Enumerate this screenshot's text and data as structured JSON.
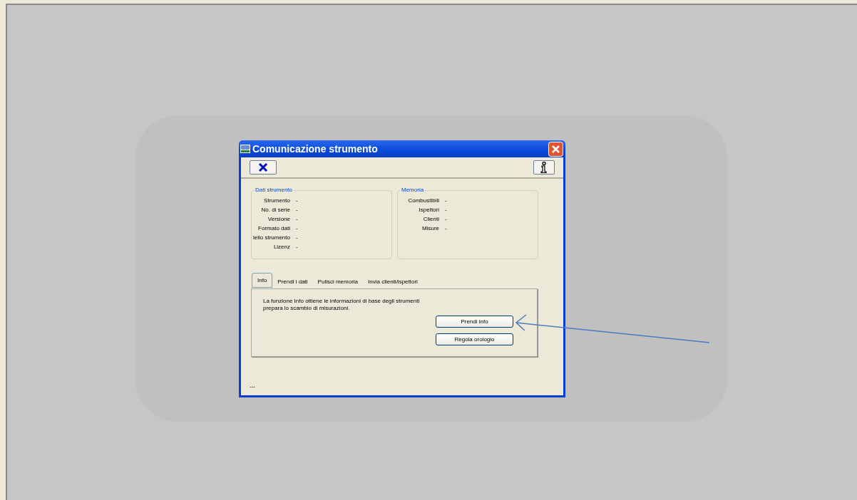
{
  "window": {
    "title": "Comunicazione strumento"
  },
  "groups": [
    {
      "title": "Dati strumento",
      "fields": [
        {
          "label": "Strumento",
          "value": "-"
        },
        {
          "label": "No. di serie",
          "value": "-"
        },
        {
          "label": "Versione",
          "value": "-"
        },
        {
          "label": "Formato dati",
          "value": "-"
        },
        {
          "label": "lello strumento",
          "value": "-"
        },
        {
          "label": "Lizenz",
          "value": "-"
        }
      ]
    },
    {
      "title": "Memoria",
      "fields": [
        {
          "label": "Combustibili",
          "value": "-"
        },
        {
          "label": "Ispettori",
          "value": "-"
        },
        {
          "label": "Clienti",
          "value": "-"
        },
        {
          "label": "Misure",
          "value": "-"
        }
      ]
    }
  ],
  "tabs": [
    {
      "label": "Info",
      "selected": true
    },
    {
      "label": "Prendi i dati",
      "selected": false
    },
    {
      "label": "Pulisci memoria",
      "selected": false
    },
    {
      "label": "Invia clienti/ispettori",
      "selected": false
    }
  ],
  "panel": {
    "description_lines": [
      "La funzione Info ottiene le informazioni di base degli strumenti",
      "prepara lo scambio di misurazioni."
    ],
    "buttons": [
      "Prendi info",
      "Regola orologio"
    ]
  },
  "status_bar": "---"
}
